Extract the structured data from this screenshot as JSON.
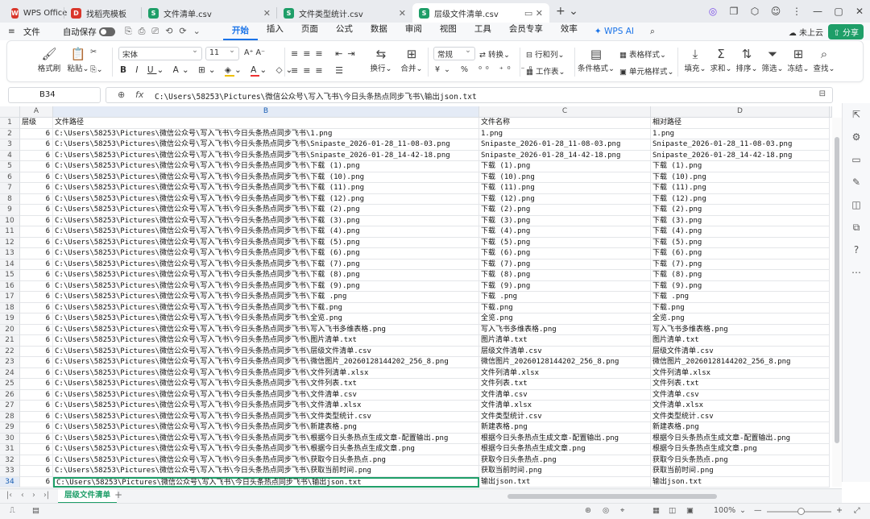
{
  "tabs": [
    {
      "label": "WPS Office",
      "icon": "W",
      "color": "#d9362b"
    },
    {
      "label": "找稻壳模板",
      "icon": "D",
      "color": "#d9362b"
    },
    {
      "label": "文件清单.csv",
      "icon": "S",
      "color": "#1e9e68"
    },
    {
      "label": "文件类型统计.csv",
      "icon": "S",
      "color": "#1e9e68"
    },
    {
      "label": "层级文件清单.csv",
      "icon": "S",
      "color": "#1e9e68"
    }
  ],
  "menu": {
    "file": "文件",
    "autosave": "自动保存",
    "items": [
      "开始",
      "插入",
      "页面",
      "公式",
      "数据",
      "审阅",
      "视图",
      "工具",
      "会员专享",
      "效率"
    ],
    "wps_ai": "WPS AI",
    "cloud": "未上云",
    "share": "分享"
  },
  "ribbon": {
    "format_painter": "格式刷",
    "paste": "粘贴",
    "font": "宋体",
    "size": "11",
    "number_format": "常规",
    "convert": "转换",
    "wrap": "换行",
    "merge": "合并",
    "row_col": "行和列",
    "worksheet": "工作表",
    "cond_format": "条件格式",
    "table_style": "表格样式",
    "cell_style": "单元格样式",
    "fill": "填充",
    "sum": "求和",
    "sort": "排序",
    "filter": "筛选",
    "freeze": "冻结",
    "find": "查找"
  },
  "formula_bar": {
    "cell_ref": "B34",
    "fx": "fx",
    "value": "C:\\Users\\58253\\Pictures\\微信公众号\\写入飞书\\今日头条热点同步飞书\\输出json.txt"
  },
  "columns": [
    "A",
    "B",
    "C",
    "D"
  ],
  "rows": [
    [
      "层级",
      "文件路径",
      "文件名称",
      "相对路径"
    ],
    [
      "6",
      "C:\\Users\\58253\\Pictures\\微信公众号\\写入飞书\\今日头条热点同步飞书\\1.png",
      "1.png",
      "1.png"
    ],
    [
      "6",
      "C:\\Users\\58253\\Pictures\\微信公众号\\写入飞书\\今日头条热点同步飞书\\Snipaste_2026-01-28_11-08-03.png",
      "Snipaste_2026-01-28_11-08-03.png",
      "Snipaste_2026-01-28_11-08-03.png"
    ],
    [
      "6",
      "C:\\Users\\58253\\Pictures\\微信公众号\\写入飞书\\今日头条热点同步飞书\\Snipaste_2026-01-28_14-42-18.png",
      "Snipaste_2026-01-28_14-42-18.png",
      "Snipaste_2026-01-28_14-42-18.png"
    ],
    [
      "6",
      "C:\\Users\\58253\\Pictures\\微信公众号\\写入飞书\\今日头条热点同步飞书\\下载 (1).png",
      "下载 (1).png",
      "下载 (1).png"
    ],
    [
      "6",
      "C:\\Users\\58253\\Pictures\\微信公众号\\写入飞书\\今日头条热点同步飞书\\下载 (10).png",
      "下载 (10).png",
      "下载 (10).png"
    ],
    [
      "6",
      "C:\\Users\\58253\\Pictures\\微信公众号\\写入飞书\\今日头条热点同步飞书\\下载 (11).png",
      "下载 (11).png",
      "下载 (11).png"
    ],
    [
      "6",
      "C:\\Users\\58253\\Pictures\\微信公众号\\写入飞书\\今日头条热点同步飞书\\下载 (12).png",
      "下载 (12).png",
      "下载 (12).png"
    ],
    [
      "6",
      "C:\\Users\\58253\\Pictures\\微信公众号\\写入飞书\\今日头条热点同步飞书\\下载 (2).png",
      "下载 (2).png",
      "下载 (2).png"
    ],
    [
      "6",
      "C:\\Users\\58253\\Pictures\\微信公众号\\写入飞书\\今日头条热点同步飞书\\下载 (3).png",
      "下载 (3).png",
      "下载 (3).png"
    ],
    [
      "6",
      "C:\\Users\\58253\\Pictures\\微信公众号\\写入飞书\\今日头条热点同步飞书\\下载 (4).png",
      "下载 (4).png",
      "下载 (4).png"
    ],
    [
      "6",
      "C:\\Users\\58253\\Pictures\\微信公众号\\写入飞书\\今日头条热点同步飞书\\下载 (5).png",
      "下载 (5).png",
      "下载 (5).png"
    ],
    [
      "6",
      "C:\\Users\\58253\\Pictures\\微信公众号\\写入飞书\\今日头条热点同步飞书\\下载 (6).png",
      "下载 (6).png",
      "下载 (6).png"
    ],
    [
      "6",
      "C:\\Users\\58253\\Pictures\\微信公众号\\写入飞书\\今日头条热点同步飞书\\下载 (7).png",
      "下载 (7).png",
      "下载 (7).png"
    ],
    [
      "6",
      "C:\\Users\\58253\\Pictures\\微信公众号\\写入飞书\\今日头条热点同步飞书\\下载 (8).png",
      "下载 (8).png",
      "下载 (8).png"
    ],
    [
      "6",
      "C:\\Users\\58253\\Pictures\\微信公众号\\写入飞书\\今日头条热点同步飞书\\下载 (9).png",
      "下载 (9).png",
      "下载 (9).png"
    ],
    [
      "6",
      "C:\\Users\\58253\\Pictures\\微信公众号\\写入飞书\\今日头条热点同步飞书\\下载 .png",
      "下载 .png",
      "下载 .png"
    ],
    [
      "6",
      "C:\\Users\\58253\\Pictures\\微信公众号\\写入飞书\\今日头条热点同步飞书\\下载.png",
      "下载.png",
      "下载.png"
    ],
    [
      "6",
      "C:\\Users\\58253\\Pictures\\微信公众号\\写入飞书\\今日头条热点同步飞书\\全览.png",
      "全览.png",
      "全览.png"
    ],
    [
      "6",
      "C:\\Users\\58253\\Pictures\\微信公众号\\写入飞书\\今日头条热点同步飞书\\写入飞书多维表格.png",
      "写入飞书多维表格.png",
      "写入飞书多维表格.png"
    ],
    [
      "6",
      "C:\\Users\\58253\\Pictures\\微信公众号\\写入飞书\\今日头条热点同步飞书\\图片清单.txt",
      "图片清单.txt",
      "图片清单.txt"
    ],
    [
      "6",
      "C:\\Users\\58253\\Pictures\\微信公众号\\写入飞书\\今日头条热点同步飞书\\层级文件清单.csv",
      "层级文件清单.csv",
      "层级文件清单.csv"
    ],
    [
      "6",
      "C:\\Users\\58253\\Pictures\\微信公众号\\写入飞书\\今日头条热点同步飞书\\微信图片_20260128144202_256_8.png",
      "微信图片_20260128144202_256_8.png",
      "微信图片_20260128144202_256_8.png"
    ],
    [
      "6",
      "C:\\Users\\58253\\Pictures\\微信公众号\\写入飞书\\今日头条热点同步飞书\\文件列清单.xlsx",
      "文件列清单.xlsx",
      "文件列清单.xlsx"
    ],
    [
      "6",
      "C:\\Users\\58253\\Pictures\\微信公众号\\写入飞书\\今日头条热点同步飞书\\文件列表.txt",
      "文件列表.txt",
      "文件列表.txt"
    ],
    [
      "6",
      "C:\\Users\\58253\\Pictures\\微信公众号\\写入飞书\\今日头条热点同步飞书\\文件清单.csv",
      "文件清单.csv",
      "文件清单.csv"
    ],
    [
      "6",
      "C:\\Users\\58253\\Pictures\\微信公众号\\写入飞书\\今日头条热点同步飞书\\文件清单.xlsx",
      "文件清单.xlsx",
      "文件清单.xlsx"
    ],
    [
      "6",
      "C:\\Users\\58253\\Pictures\\微信公众号\\写入飞书\\今日头条热点同步飞书\\文件类型统计.csv",
      "文件类型统计.csv",
      "文件类型统计.csv"
    ],
    [
      "6",
      "C:\\Users\\58253\\Pictures\\微信公众号\\写入飞书\\今日头条热点同步飞书\\新建表格.png",
      "新建表格.png",
      "新建表格.png"
    ],
    [
      "6",
      "C:\\Users\\58253\\Pictures\\微信公众号\\写入飞书\\今日头条热点同步飞书\\根据今日头条热点生成文章-配置输出.png",
      "根据今日头条热点生成文章-配置输出.png",
      "根据今日头条热点生成文章-配置输出.png"
    ],
    [
      "6",
      "C:\\Users\\58253\\Pictures\\微信公众号\\写入飞书\\今日头条热点同步飞书\\根据今日头条热点生成文章.png",
      "根据今日头条热点生成文章.png",
      "根据今日头条热点生成文章.png"
    ],
    [
      "6",
      "C:\\Users\\58253\\Pictures\\微信公众号\\写入飞书\\今日头条热点同步飞书\\获取今日头条热点.png",
      "获取今日头条热点.png",
      "获取今日头条热点.png"
    ],
    [
      "6",
      "C:\\Users\\58253\\Pictures\\微信公众号\\写入飞书\\今日头条热点同步飞书\\获取当前时间.png",
      "获取当前时间.png",
      "获取当前时间.png"
    ],
    [
      "6",
      "C:\\Users\\58253\\Pictures\\微信公众号\\写入飞书\\今日头条热点同步飞书\\输出json.txt",
      "输出json.txt",
      "输出json.txt"
    ]
  ],
  "sheet_tab": "层级文件清单",
  "status": {
    "zoom": "100%"
  }
}
